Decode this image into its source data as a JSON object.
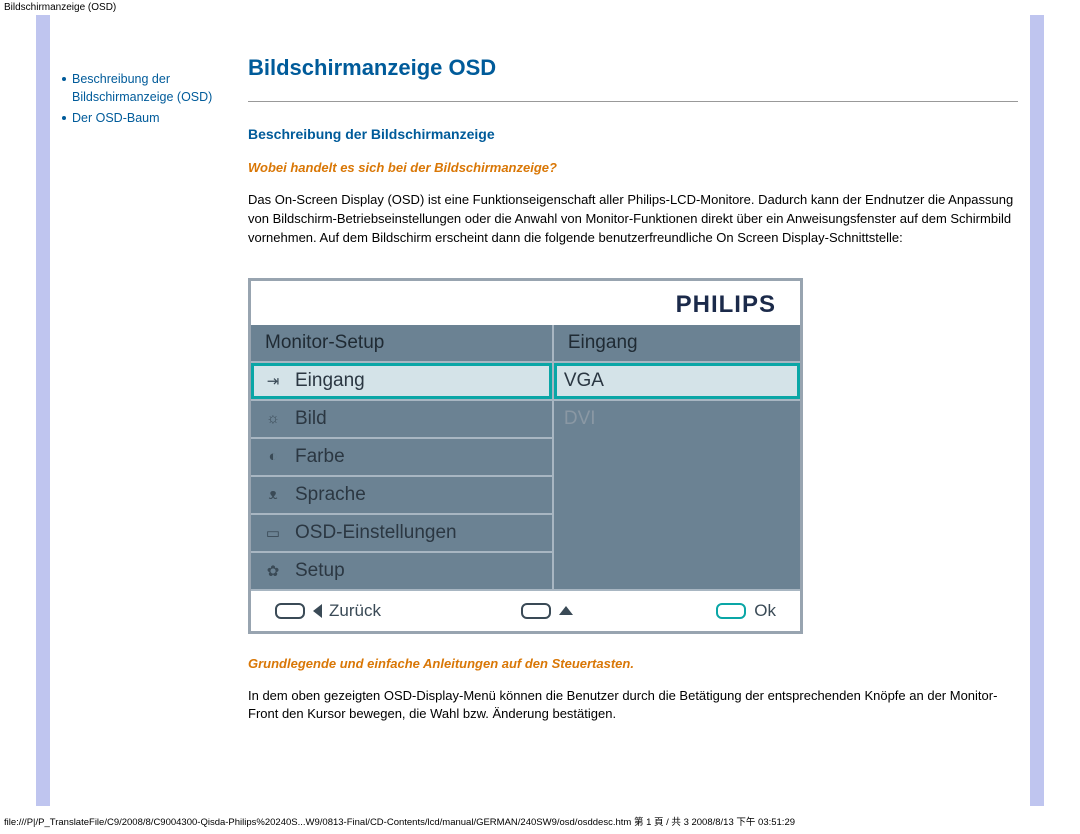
{
  "meta": {
    "header_text": "Bildschirmanzeige (OSD)",
    "footer_text": "file:///P|/P_TranslateFile/C9/2008/8/C9004300-Qisda-Philips%20240S...W9/0813-Final/CD-Contents/lcd/manual/GERMAN/240SW9/osd/osddesc.htm 第 1 頁 / 共 3 2008/8/13 下午 03:51:29"
  },
  "sidebar": {
    "items": [
      {
        "label": "Beschreibung der Bildschirmanzeige (OSD)"
      },
      {
        "label": "Der OSD-Baum"
      }
    ]
  },
  "main": {
    "title": "Bildschirmanzeige OSD",
    "section_heading": "Beschreibung der Bildschirmanzeige",
    "question": "Wobei handelt es sich bei der Bildschirmanzeige?",
    "paragraph_intro": "Das On-Screen Display (OSD) ist eine Funktionseigenschaft aller Philips-LCD-Monitore. Dadurch kann der Endnutzer die Anpassung von Bildschirm-Betriebseinstellungen oder die Anwahl von Monitor-Funktionen direkt über ein Anweisungsfenster auf dem Schirmbild vornehmen. Auf dem Bildschirm erscheint dann die folgende benutzerfreundliche On Screen Display-Schnittstelle:",
    "instructions_heading": "Grundlegende und einfache Anleitungen auf den Steuertasten.",
    "paragraph_instructions": "In dem oben gezeigten OSD-Display-Menü können die Benutzer durch die Betätigung der entsprechenden Knöpfe an der Monitor-Front den Kursor bewegen, die Wahl bzw. Änderung bestätigen."
  },
  "osd": {
    "brand": "PHILIPS",
    "left_header": "Monitor-Setup",
    "left_items": [
      "Eingang",
      "Bild",
      "Farbe",
      "Sprache",
      "OSD-Einstellungen",
      "Setup"
    ],
    "right_header": "Eingang",
    "right_items": [
      "VGA",
      "DVI"
    ],
    "footer": {
      "back": "Zurück",
      "ok": "Ok"
    }
  }
}
